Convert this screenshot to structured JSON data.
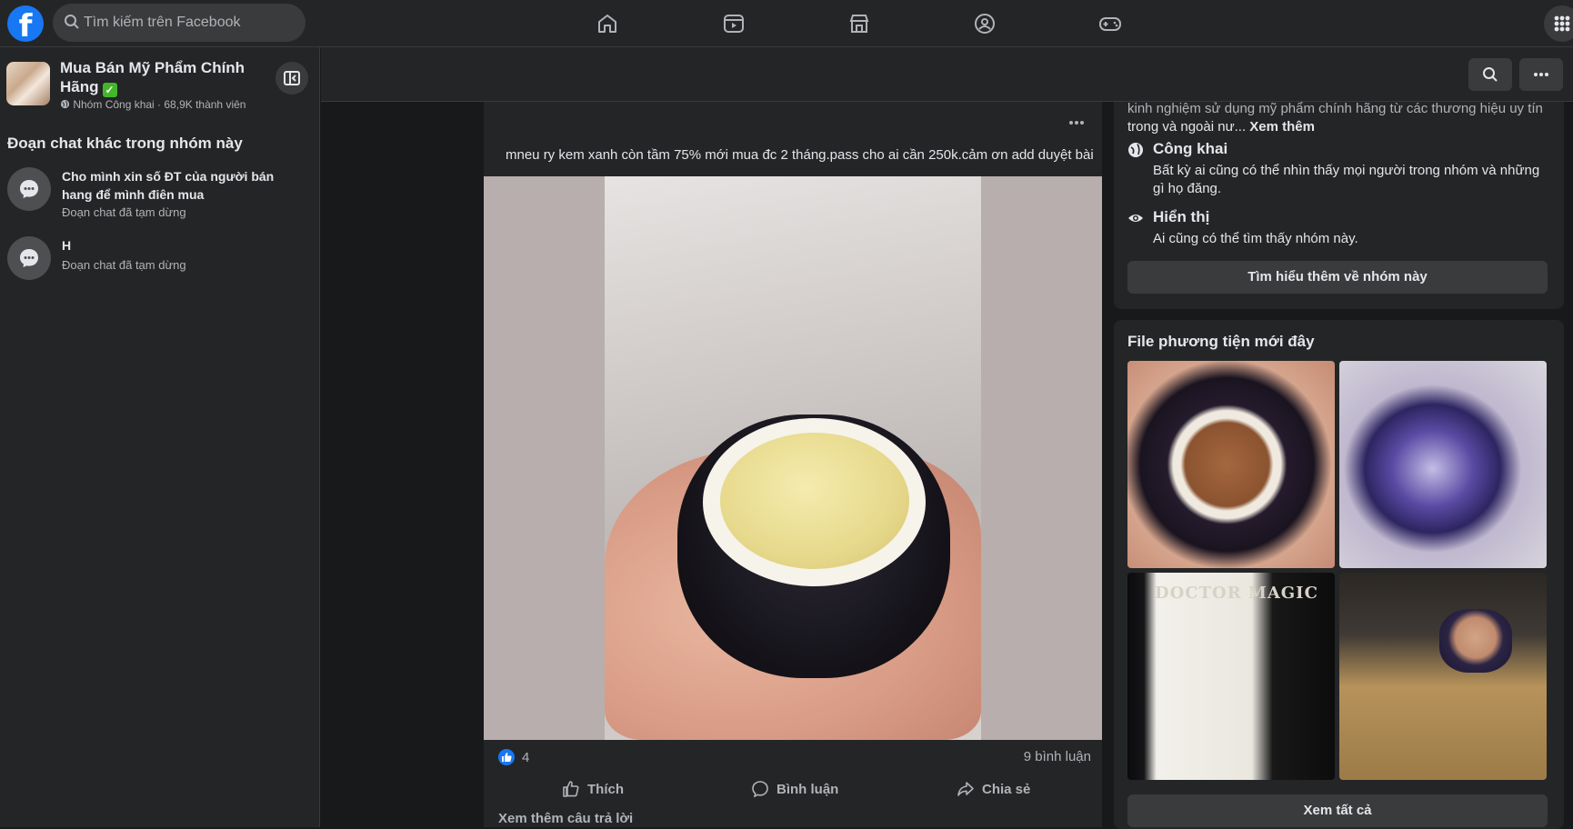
{
  "topbar": {
    "logo": "f",
    "search_placeholder": "Tìm kiếm trên Facebook",
    "nav_icons": [
      "home-icon",
      "video-icon",
      "marketplace-icon",
      "groups-icon",
      "gaming-icon"
    ]
  },
  "sidebar": {
    "group_name": "Mua Bán Mỹ Phẩm Chính Hãng",
    "group_meta": "Nhóm Công khai · 68,9K thành viên",
    "chats_heading": "Đoạn chat khác trong nhóm này",
    "chats": [
      {
        "title": "Cho mình xin số ĐT của người bán hang để mình điên mua",
        "status": "Đoạn chat đã tạm dừng"
      },
      {
        "title": "H",
        "status": "Đoạn chat đã tạm dừng"
      }
    ]
  },
  "post": {
    "text": "mneu ry kem xanh còn tầm 75% mới mua đc 2 tháng.pass cho ai cần 250k.cảm ơn add duyệt bài",
    "reaction_count": "4",
    "comment_count": "9 bình luận",
    "actions": {
      "like": "Thích",
      "comment": "Bình luận",
      "share": "Chia sẻ"
    },
    "see_more_replies": "Xem thêm câu trả lời"
  },
  "about": {
    "desc_faded": "kinh nghiệm sử dụng mỹ phẩm chính hãng từ các thương hiệu uy tín",
    "desc_line2": "trong và ngoài nư...",
    "see_more": "Xem thêm",
    "public_title": "Công khai",
    "public_desc": "Bất kỳ ai cũng có thể nhìn thấy mọi người trong nhóm và những gì họ đăng.",
    "visible_title": "Hiển thị",
    "visible_desc": "Ai cũng có thể tìm thấy nhóm này.",
    "learn_more": "Tìm hiểu thêm về nhóm này"
  },
  "media": {
    "title": "File phương tiện mới đây",
    "brand_text": "DOCTOR MAGIC",
    "see_all": "Xem tất cả"
  },
  "colors": {
    "accent": "#1877f2",
    "surface": "#242526",
    "background": "#18191a",
    "verified": "#42b72a"
  }
}
